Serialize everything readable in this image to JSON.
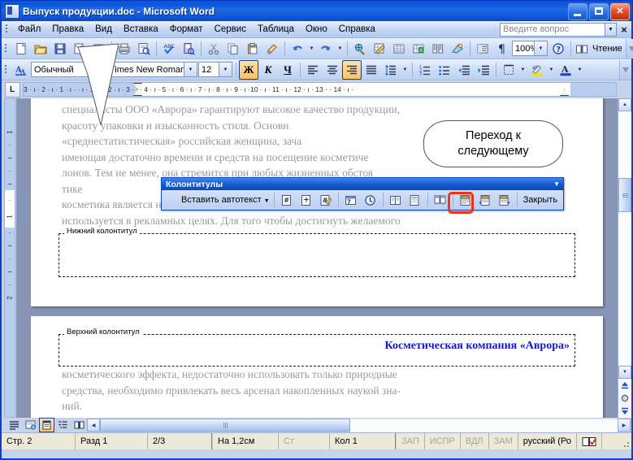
{
  "window": {
    "title": "Выпуск продукции.doc - Microsoft Word",
    "minimize_label": "Свернуть",
    "maximize_label": "Развернуть",
    "close_label": "Закрыть"
  },
  "menu": {
    "items": [
      "Файл",
      "Правка",
      "Вид",
      "Вставка",
      "Формат",
      "Сервис",
      "Таблица",
      "Окно",
      "Справка"
    ],
    "ask_placeholder": "Введите вопрос",
    "close_label": "×"
  },
  "standard_toolbar": {
    "zoom_value": "100%",
    "read_label": "Чтение",
    "icons": [
      "new-document-icon",
      "open-folder-icon",
      "save-icon",
      "email-icon",
      "permission-icon",
      "print-icon",
      "print-preview-icon",
      "spelling-icon",
      "research-icon",
      "cut-icon",
      "copy-icon",
      "paste-icon",
      "format-painter-icon",
      "undo-icon",
      "redo-icon",
      "hyperlink-icon",
      "tables-and-borders-icon",
      "insert-table-icon",
      "insert-excel-sheet-icon",
      "columns-icon",
      "drawing-icon",
      "document-map-icon",
      "show-formatting-icon",
      "zoom-icon",
      "help-icon",
      "reading-layout-icon"
    ]
  },
  "formatting_toolbar": {
    "style_value": "Обычный",
    "font_value": "Times New Roman",
    "size_value": "12",
    "bold_label": "Ж",
    "italic_label": "К",
    "underline_label": "Ч",
    "icons": [
      "styles-and-formatting-icon",
      "align-left-icon",
      "align-center-icon",
      "align-right-icon",
      "justify-icon",
      "line-spacing-icon",
      "numbered-list-icon",
      "bulleted-list-icon",
      "decrease-indent-icon",
      "increase-indent-icon",
      "borders-icon",
      "highlight-icon",
      "font-color-icon"
    ],
    "active": [
      "bold",
      "justify"
    ]
  },
  "ruler": {
    "tab_stop_glyph": "L",
    "horizontal_ticks": "3 · ı · 2 · ı · 1 · ı ·        · ı · 1 · ı · 2 · ı · 3 · ı · 4 · ı · 5 · ı · 6 · ı · 7 · ı · 8 · ı · 9 · ı ·10 · ı · 11 · ı · 12 · ı · 13 ·      · 14 · ı ·",
    "vertical_ticks": [
      "1",
      "·",
      "ı",
      "·",
      "ı",
      "·",
      "1",
      "·",
      "ı",
      "·",
      "ı",
      "·",
      "2",
      "·"
    ]
  },
  "document": {
    "page1_lines": [
      "специалисты  ООО  «Аврора»  гарантируют  высокое  качество  продукции,",
      "красоту  упаковки  и  изысканность  стиля.  Основн",
      "«среднестатистическая» российская женщина, зача",
      "имеющая достаточно времени и средств на посещение косметиче",
      "лонов. Тем не менее, она стремится при любых жизненных обстоя"
    ],
    "page1_lines_after_toolbar": [
      "тике",
      "косметика  является  на  100 %  натуральной  –  это  миф,  который  широко",
      "используется в рекламных целях. Для того чтобы достигнуть желаемого"
    ],
    "footer_label": "Нижний колонтитул",
    "header_label": "Верхний колонтитул",
    "header_text": "Косметическая компания «Аврора»",
    "page2_lines": [
      "косметического  эффекта,  недостаточно  использовать  только  природные",
      "средства, необходимо привлекать весь арсенал накопленных наукой зна-",
      "ний."
    ]
  },
  "header_footer_toolbar": {
    "title": "Колонтитулы",
    "autotext_label": "Вставить автотекст",
    "close_label": "Закрыть",
    "buttons": [
      "insert-page-number-icon",
      "insert-number-of-pages-icon",
      "format-page-number-icon",
      "insert-date-icon",
      "insert-time-icon",
      "page-setup-icon",
      "show-hide-document-text-icon",
      "same-as-previous-icon",
      "switch-header-footer-icon",
      "show-previous-icon",
      "show-next-icon"
    ],
    "highlighted_button": "show-next-icon"
  },
  "callout": {
    "text": "Переход к следующему",
    "highlight_color": "#f1311a"
  },
  "status_bar": {
    "page": "Стр. 2",
    "section": "Разд 1",
    "page_of": "2/3",
    "at": "На 1,2см",
    "line": "Ст",
    "column": "Кол 1",
    "rec": "ЗАП",
    "trk": "ИСПР",
    "ext": "ВДЛ",
    "ovr": "ЗАМ",
    "language": "русский (Ро",
    "spell_icon": "spelling-status-icon"
  },
  "view_buttons": {
    "items": [
      "normal-view-icon",
      "web-layout-view-icon",
      "print-layout-view-icon",
      "outline-view-icon",
      "reading-view-icon"
    ],
    "active": "print-layout-view-icon"
  },
  "colors": {
    "titlebar_blue": "#0b51d6",
    "toolbar_blue": "#cfdff7",
    "page_background": "#8694b5",
    "header_text_blue": "#1616d0",
    "highlight_orange": "#fdc264",
    "status_bg": "#ece9d8"
  }
}
